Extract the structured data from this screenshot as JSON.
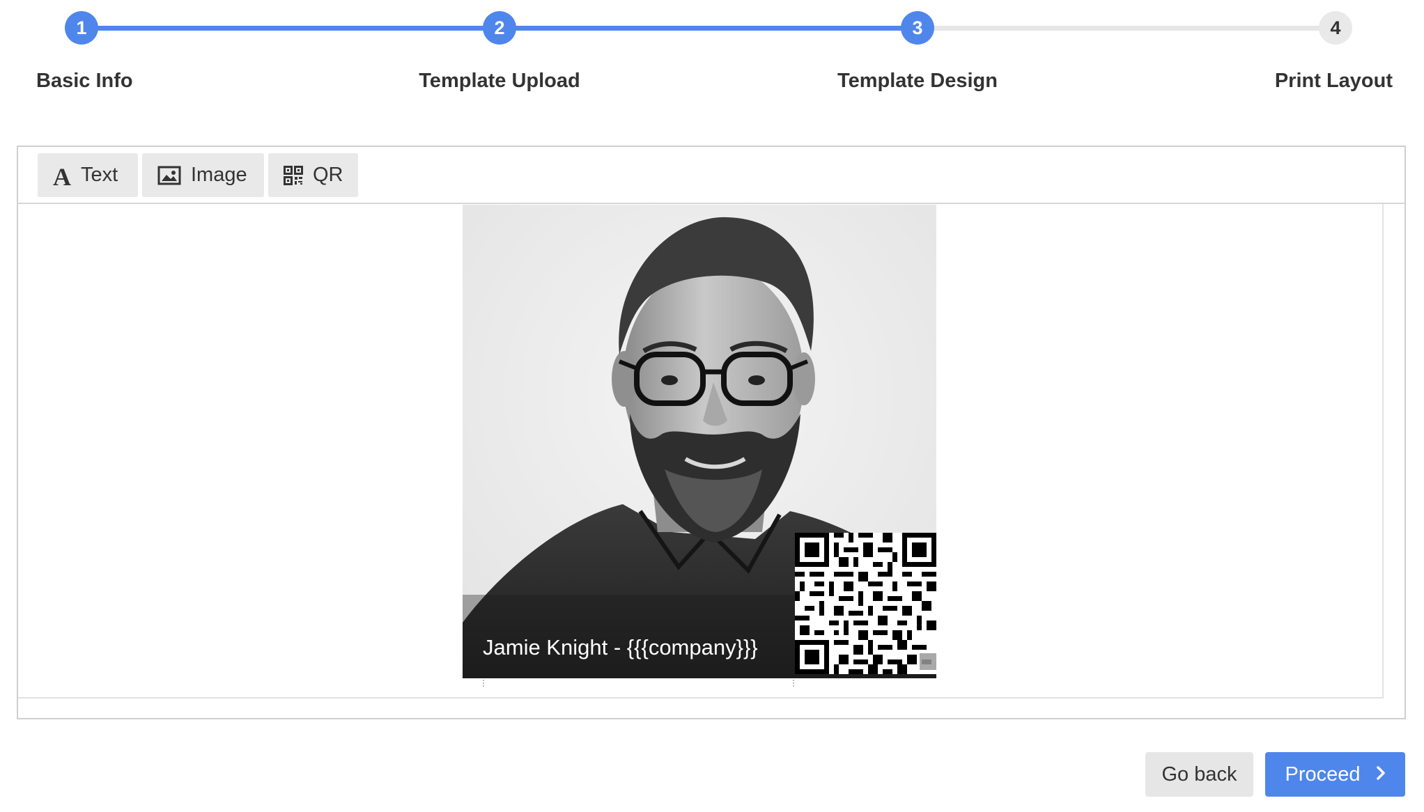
{
  "stepper": {
    "steps": [
      {
        "number": "1",
        "label": "Basic Info",
        "state": "complete"
      },
      {
        "number": "2",
        "label": "Template Upload",
        "state": "complete"
      },
      {
        "number": "3",
        "label": "Template Design",
        "state": "current"
      },
      {
        "number": "4",
        "label": "Print Layout",
        "state": "upcoming"
      }
    ],
    "active_color": "#4f86ec",
    "inactive_color": "#e9e9e9"
  },
  "toolbar": {
    "text_label": "Text",
    "image_label": "Image",
    "qr_label": "QR",
    "text_icon_glyph": "A",
    "image_icon": "image-icon",
    "qr_icon": "qr-code-icon"
  },
  "canvas": {
    "name_field": "Jamie Knight - {{{company}}}",
    "photo_description": "grayscale-portrait-photo",
    "qr_element": "qr-code"
  },
  "footer": {
    "back_label": "Go back",
    "proceed_label": "Proceed",
    "proceed_icon": "chevron-right-icon"
  }
}
